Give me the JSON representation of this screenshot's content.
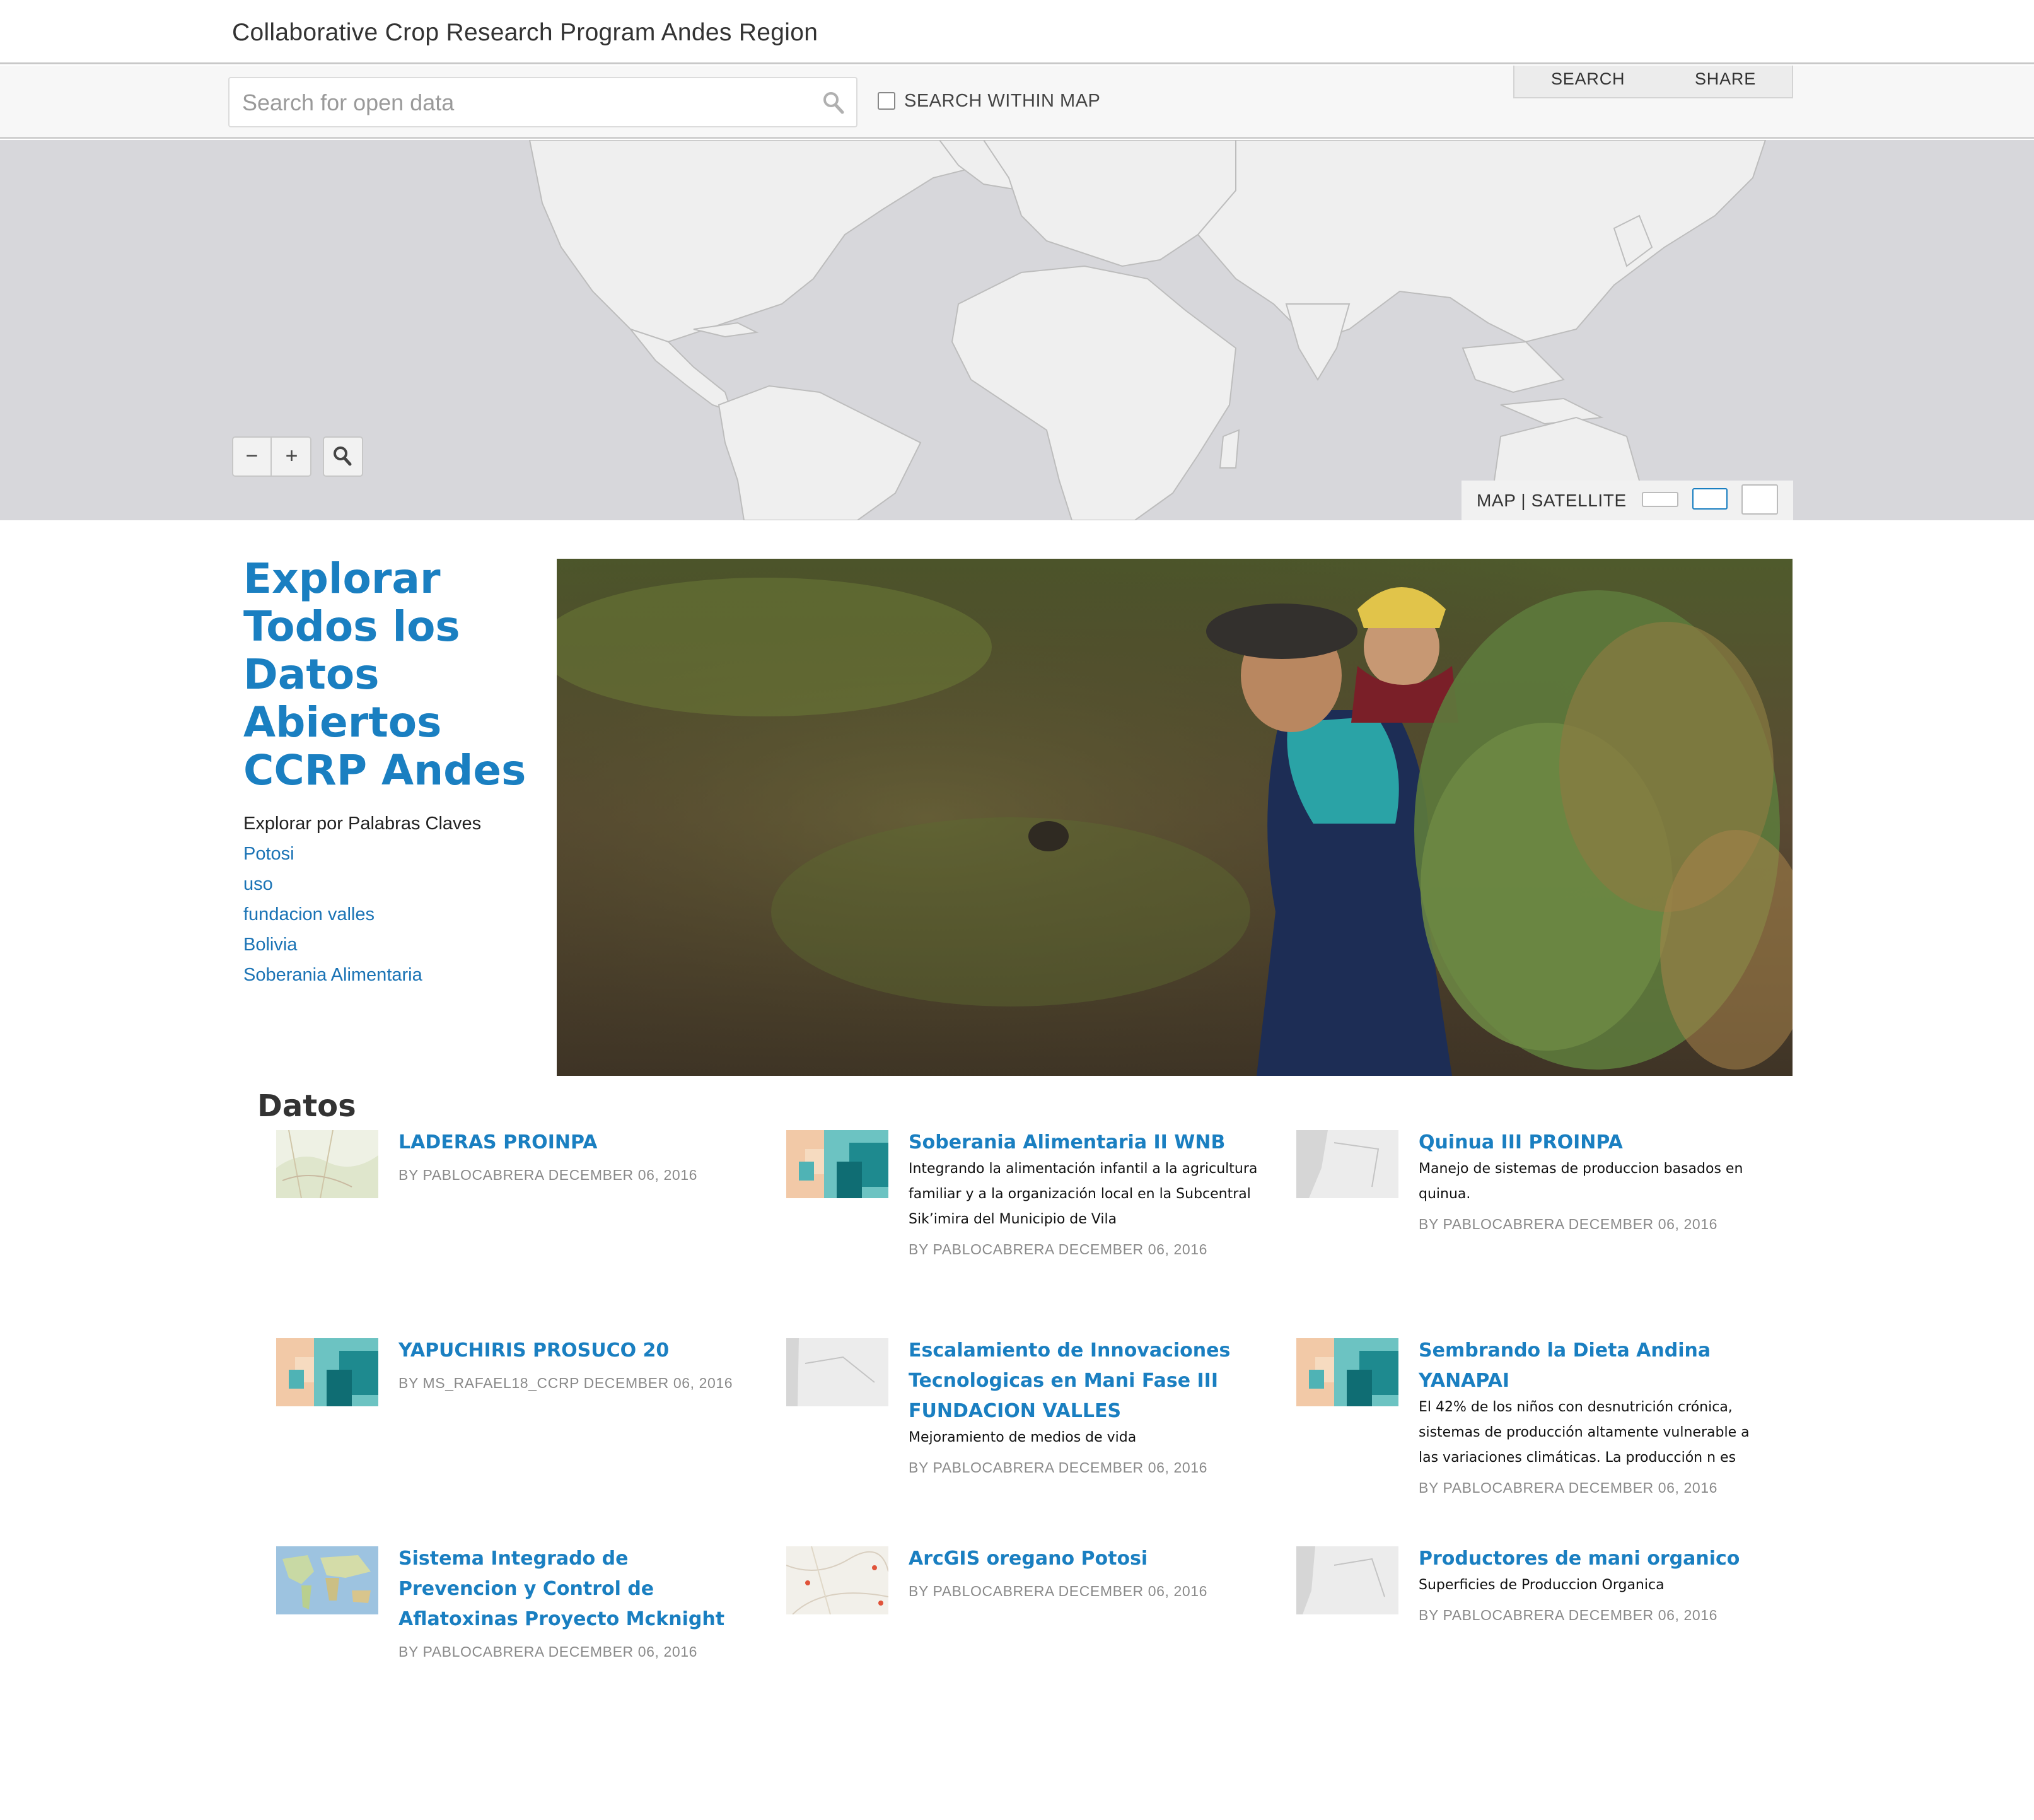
{
  "header": {
    "title": "Collaborative Crop Research Program Andes Region"
  },
  "search": {
    "placeholder": "Search for open data",
    "within_map_label": "SEARCH WITHIN MAP",
    "tabs": [
      "SEARCH",
      "SHARE"
    ]
  },
  "map": {
    "zoom_out": "−",
    "zoom_in": "+",
    "basemap_label": "MAP | SATELLITE",
    "colors": {
      "water": "#d7d7db",
      "land": "#efefef",
      "borders": "#bdbdbd"
    }
  },
  "intro": {
    "title": "Explorar Todos los Datos Abiertos CCRP Andes",
    "keywords_heading": "Explorar por Palabras Claves",
    "keywords": [
      "Potosi",
      "uso",
      "fundacion valles",
      "Bolivia",
      "Soberania Alimentaria"
    ]
  },
  "datos": {
    "heading": "Datos",
    "items": [
      {
        "title": "LADERAS PROINPA",
        "description": "",
        "meta": "BY PABLOCABRERA DECEMBER 06, 2016",
        "thumb": "topo-map-thumb"
      },
      {
        "title": "Soberania Alimentaria II WNB",
        "description": "Integrando la alimentación infantil a la agricultura familiar y a la organización local en la Subcentral Sik’imira del Municipio de Vila",
        "meta": "BY PABLOCABRERA DECEMBER 06, 2016",
        "thumb": "choropleth-thumb"
      },
      {
        "title": "Quinua III PROINPA",
        "description": "Manejo de sistemas de produccion basados en quinua.",
        "meta": "BY PABLOCABRERA DECEMBER 06, 2016",
        "thumb": "gray-map-thumb"
      },
      {
        "title": "YAPUCHIRIS PROSUCO 20",
        "description": "",
        "meta": "BY MS_RAFAEL18_CCRP DECEMBER 06, 2016",
        "thumb": "choropleth-thumb"
      },
      {
        "title": "Escalamiento de Innovaciones Tecnologicas en Mani Fase III FUNDACION VALLES",
        "description": "Mejoramiento de medios de vida",
        "meta": "BY PABLOCABRERA DECEMBER 06, 2016",
        "thumb": "gray-map-thumb"
      },
      {
        "title": "Sembrando la Dieta Andina YANAPAI",
        "description": "El 42% de los niños con desnutrición crónica, sistemas de producción altamente vulnerable a las variaciones climáticas. La producción n es",
        "meta": "BY PABLOCABRERA DECEMBER 06, 2016",
        "thumb": "choropleth-thumb"
      },
      {
        "title": "Sistema Integrado de Prevencion y Control de Aflatoxinas Proyecto Mcknight",
        "description": "",
        "meta": "BY PABLOCABRERA DECEMBER 06, 2016",
        "thumb": "world-map-thumb"
      },
      {
        "title": "ArcGIS oregano Potosi",
        "description": "",
        "meta": "BY PABLOCABRERA DECEMBER 06, 2016",
        "thumb": "street-map-thumb"
      },
      {
        "title": "Productores de mani organico",
        "description": "Superficies de Produccion Organica",
        "meta": "BY PABLOCABRERA DECEMBER 06, 2016",
        "thumb": "gray-map-thumb"
      }
    ]
  }
}
